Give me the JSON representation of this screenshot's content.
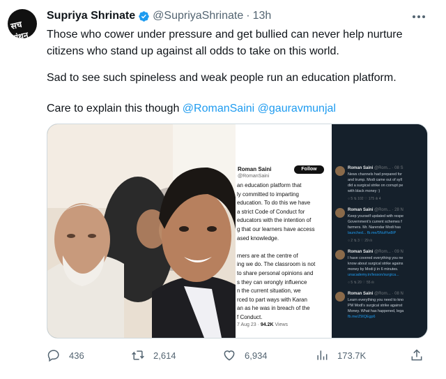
{
  "author": {
    "name": "Supriya Shrinate",
    "handle": "@SupriyaShrinate",
    "separator": "·",
    "time": "13h",
    "avatar_text": "सच मंथन",
    "verified_color": "#1d9bf0"
  },
  "tweet": {
    "line1": "Those who cower under pressure and get bullied can never help nurture citizens who stand up against all odds to take on this world.",
    "line2": "Sad to see such spineless and weak people run an education platform.",
    "line3_text": "Care to explain this though ",
    "mention1": "@RomanSaini",
    "mention2": "@gauravmunjal"
  },
  "media": {
    "doc": {
      "name": "Roman Saini",
      "handle": "@RomanSaini",
      "follow_label": "Follow",
      "lines": [
        "an education platform that",
        "ly committed to imparting",
        "education. To do this we have",
        "a strict Code of Conduct for",
        "educators with the intention of",
        "g that our learners have access",
        "ased knowledge.",
        "",
        "rners are at the centre of",
        "ing we do. The classroom is not",
        " to share personal opinions and",
        "s they can wrongly influence",
        "n the current situation, we",
        "rced to part ways with Karan",
        "an as he was in breach of the",
        "f Conduct."
      ],
      "footer_date": "7 Aug 23 · ",
      "footer_views": "94.2K",
      "footer_views_label": " Views"
    },
    "dark_tweets": [
      {
        "name": "Roman Saini",
        "meta": " @Rom... · 08 S",
        "lines": [
          "News channels had prepared for",
          "and trump. Modi came out of syll",
          "did a surgical strike on corrupt pe",
          "with black money :)"
        ],
        "stats": "○ 5    ⇅ 102    ♡ 175    ılı 4"
      },
      {
        "name": "Roman Saini",
        "meta": " @Rom... · 28 N",
        "lines": [
          "Keep yourself updated with respe",
          "Government's current schemes f",
          "farmers. Mr. Narendar Modi has",
          "launched... fb.me/5NuFIw8iP"
        ],
        "stats": "○ 2    ⇅ 3    ♡ 29    ılı"
      },
      {
        "name": "Roman Saini",
        "meta": " @Rom... · 09 N",
        "lines": [
          "I have covered everything you ne",
          "know about surgical strike agains",
          "money by Modi ji in 6 minutes.",
          "unacademy.in/lesson/surgica..."
        ],
        "stats": "○ 5    ⇅ 20    ♡ 55    ılı"
      },
      {
        "name": "Roman Saini",
        "meta": " @Rom... · 08 N",
        "lines": [
          "Learn everything you need to kno",
          "PM Modi's surgical strike against",
          "Money. What has happened, lega",
          "fb.me/Z9IQEgp6"
        ],
        "stats": ""
      }
    ]
  },
  "actions": {
    "replies": "436",
    "retweets": "2,614",
    "likes": "6,934",
    "views": "173.7K"
  },
  "colors": {
    "link": "#1d9bf0",
    "muted": "#536471",
    "border": "#cfd9de"
  }
}
